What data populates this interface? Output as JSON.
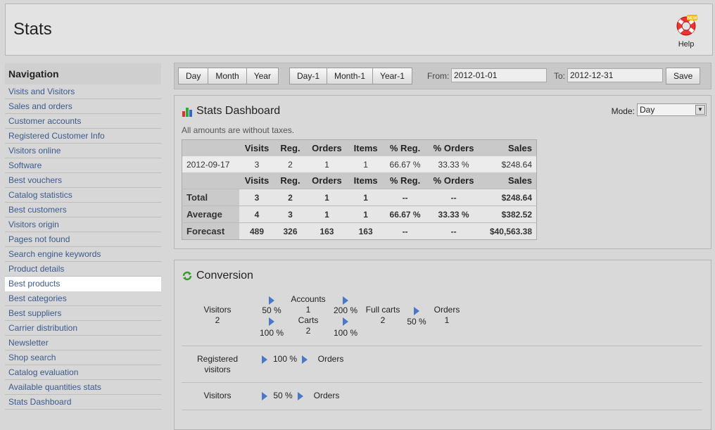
{
  "header": {
    "title": "Stats",
    "help_label": "Help",
    "help_badge": "NEW"
  },
  "sidebar": {
    "heading": "Navigation",
    "items": [
      {
        "label": "Visits and Visitors"
      },
      {
        "label": "Sales and orders"
      },
      {
        "label": "Customer accounts"
      },
      {
        "label": "Registered Customer Info"
      },
      {
        "label": "Visitors online"
      },
      {
        "label": "Software"
      },
      {
        "label": "Best vouchers"
      },
      {
        "label": "Catalog statistics"
      },
      {
        "label": "Best customers"
      },
      {
        "label": "Visitors origin"
      },
      {
        "label": "Pages not found"
      },
      {
        "label": "Search engine keywords"
      },
      {
        "label": "Product details"
      },
      {
        "label": "Best products"
      },
      {
        "label": "Best categories"
      },
      {
        "label": "Best suppliers"
      },
      {
        "label": "Carrier distribution"
      },
      {
        "label": "Newsletter"
      },
      {
        "label": "Shop search"
      },
      {
        "label": "Catalog evaluation"
      },
      {
        "label": "Available quantities stats"
      },
      {
        "label": "Stats Dashboard"
      }
    ],
    "active_label": "Best products"
  },
  "toolbar": {
    "day": "Day",
    "month": "Month",
    "year": "Year",
    "day_prev": "Day-1",
    "month_prev": "Month-1",
    "year_prev": "Year-1",
    "from_label": "From:",
    "from_value": "2012-01-01",
    "to_label": "To:",
    "to_value": "2012-12-31",
    "save": "Save"
  },
  "dashboard": {
    "title": "Stats Dashboard",
    "mode_label": "Mode:",
    "mode_value": "Day",
    "note": "All amounts are without taxes.",
    "columns": [
      "",
      "Visits",
      "Reg.",
      "Orders",
      "Items",
      "% Reg.",
      "% Orders",
      "Sales"
    ],
    "rows": [
      [
        "2012-09-17",
        "3",
        "2",
        "1",
        "1",
        "66.67 %",
        "33.33 %",
        "$248.64"
      ]
    ],
    "summary": [
      [
        "Total",
        "3",
        "2",
        "1",
        "1",
        "--",
        "--",
        "$248.64"
      ],
      [
        "Average",
        "4",
        "3",
        "1",
        "1",
        "66.67 %",
        "33.33 %",
        "$382.52"
      ],
      [
        "Forecast",
        "489",
        "326",
        "163",
        "163",
        "--",
        "--",
        "$40,563.38"
      ]
    ]
  },
  "conversion": {
    "title": "Conversion",
    "funnel1": {
      "visitors_label": "Visitors",
      "visitors_value": "2",
      "to_accounts_pct": "50 %",
      "to_carts_pct": "100 %",
      "accounts_label": "Accounts",
      "accounts_value": "1",
      "carts_label": "Carts",
      "carts_value": "2",
      "accounts_to_full_pct": "200 %",
      "carts_to_full_pct": "100 %",
      "fullcarts_label": "Full carts",
      "fullcarts_value": "2",
      "full_to_orders_pct": "50 %",
      "orders_label": "Orders",
      "orders_value": "1"
    },
    "funnel2": {
      "label": "Registered visitors",
      "pct": "100 %",
      "target": "Orders"
    },
    "funnel3": {
      "label": "Visitors",
      "pct": "50 %",
      "target": "Orders"
    }
  },
  "colors": {
    "link": "#3b5a8c",
    "arrow": "#4a78c8",
    "background": "#d7d7d7"
  }
}
